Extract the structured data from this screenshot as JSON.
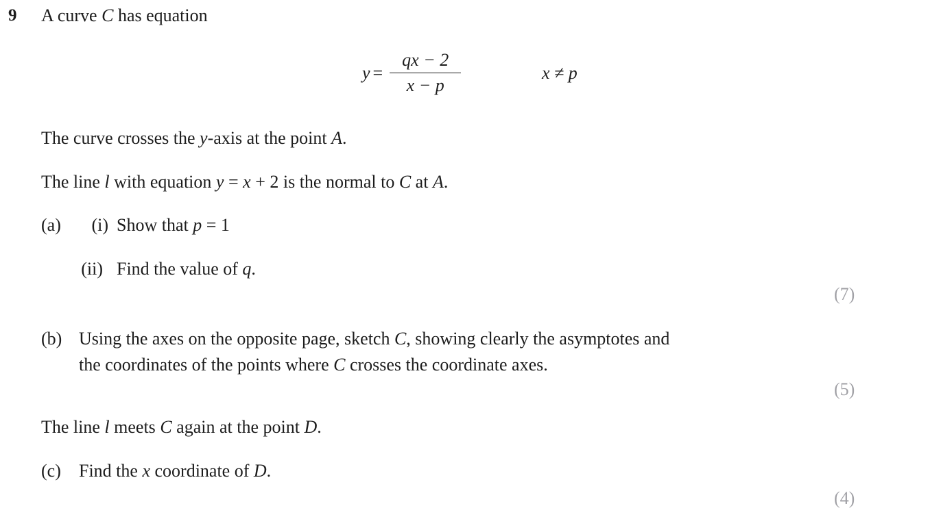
{
  "question": {
    "number": "9",
    "stem": "A curve C has equation"
  },
  "equation": {
    "lhs": "y",
    "equals": "=",
    "numerator": "qx − 2",
    "denominator": "x − p",
    "condition": "x ≠ p"
  },
  "statements": {
    "crosses_y_axis": "The curve crosses the y-axis at the point A.",
    "normal_line": "The line l with equation y = x + 2 is the normal to C at A.",
    "meets_again": "The line l meets C again at the point D."
  },
  "parts": {
    "a": {
      "label": "(a)",
      "items": [
        {
          "label": "(i)",
          "text": "Show that p = 1"
        },
        {
          "label": "(ii)",
          "text": "Find the value of q."
        }
      ],
      "marks": "(7)"
    },
    "b": {
      "label": "(b)",
      "line1": "Using the axes on the opposite page, sketch C, showing clearly the asymptotes and",
      "line2": "the coordinates of the points where C crosses the coordinate axes.",
      "marks": "(5)"
    },
    "c": {
      "label": "(c)",
      "text": "Find the x coordinate of D.",
      "marks": "(4)"
    }
  },
  "colors": {
    "text": "#1c1c1c",
    "marks": "#a1a1a6",
    "background": "#ffffff"
  }
}
